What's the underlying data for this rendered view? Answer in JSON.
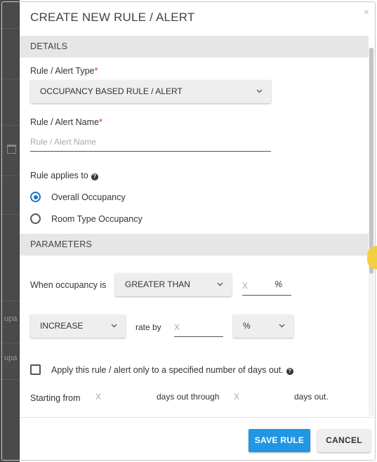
{
  "modal": {
    "title": "CREATE NEW RULE / ALERT",
    "close_glyph": "×"
  },
  "backdrop": {
    "text_1": "upa",
    "text_2": "upa"
  },
  "details": {
    "section_label": "DETAILS",
    "type_label": "Rule / Alert Type",
    "required_mark": "*",
    "type_selected": "OCCUPANCY BASED RULE / ALERT",
    "name_label": "Rule / Alert Name",
    "name_placeholder": "Rule / Alert Name",
    "applies_label": "Rule applies to",
    "applies_options": [
      {
        "label": "Overall Occupancy",
        "checked": true
      },
      {
        "label": "Room Type Occupancy",
        "checked": false
      }
    ]
  },
  "parameters": {
    "section_label": "PARAMETERS",
    "when_label": "When occupancy is",
    "comparison_selected": "GREATER THAN",
    "threshold_placeholder": "X",
    "threshold_unit": "%",
    "action_selected": "INCREASE",
    "rate_by_label": "rate by",
    "rate_placeholder": "X",
    "rate_unit_selected": "%",
    "days_out_checkbox_label": "Apply this rule / alert only to a specified number of days out.",
    "starting_from_label": "Starting from",
    "start_placeholder": "X",
    "days_out_through_label": "days out through",
    "end_placeholder": "X",
    "days_out_label": "days out."
  },
  "footer": {
    "save_label": "SAVE RULE",
    "cancel_label": "CANCEL"
  },
  "colors": {
    "primary": "#2196e3",
    "radio_checked": "#1a73c9",
    "required": "#d32f2f",
    "section_bg": "#e6e6e6"
  },
  "icons": {
    "help": "question-circle-icon",
    "chevron": "chevron-down-icon",
    "close": "close-icon",
    "calendar": "calendar-icon"
  }
}
